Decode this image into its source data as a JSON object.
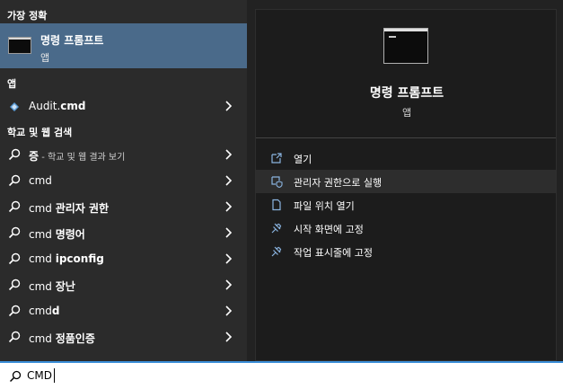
{
  "left": {
    "best_match_header": "가장 정확",
    "best_match": {
      "title": "명령 프롬프트",
      "subtitle": "앱"
    },
    "apps_header": "앱",
    "apps": [
      {
        "prefix": "Audit.",
        "bold": "cmd"
      }
    ],
    "web_header": "학교 및 웹 검색",
    "web_results": [
      {
        "prefix": "",
        "bold": "증",
        "suffix": " - 학교 및 웹 결과 보기"
      },
      {
        "prefix": "cmd",
        "bold": "",
        "suffix": ""
      },
      {
        "prefix": "cmd ",
        "bold": "관리자 권한",
        "suffix": ""
      },
      {
        "prefix": "cmd ",
        "bold": "명령어",
        "suffix": ""
      },
      {
        "prefix": "cmd ",
        "bold": "ipconfig",
        "suffix": ""
      },
      {
        "prefix": "cmd ",
        "bold": "장난",
        "suffix": ""
      },
      {
        "prefix": "cmd",
        "bold": "d",
        "suffix": ""
      },
      {
        "prefix": "cmd ",
        "bold": "정품인증",
        "suffix": ""
      }
    ]
  },
  "right": {
    "title": "명령 프롬프트",
    "subtitle": "앱",
    "actions": [
      {
        "label": "열기",
        "icon": "open-icon"
      },
      {
        "label": "관리자 권한으로 실행",
        "icon": "shield-icon"
      },
      {
        "label": "파일 위치 열기",
        "icon": "file-location-icon"
      },
      {
        "label": "시작 화면에 고정",
        "icon": "pin-icon"
      },
      {
        "label": "작업 표시줄에 고정",
        "icon": "pin-icon"
      }
    ]
  },
  "search": {
    "value": "CMD"
  },
  "colors": {
    "accent": "#3b8ed8",
    "selected": "#4a6a8a"
  }
}
